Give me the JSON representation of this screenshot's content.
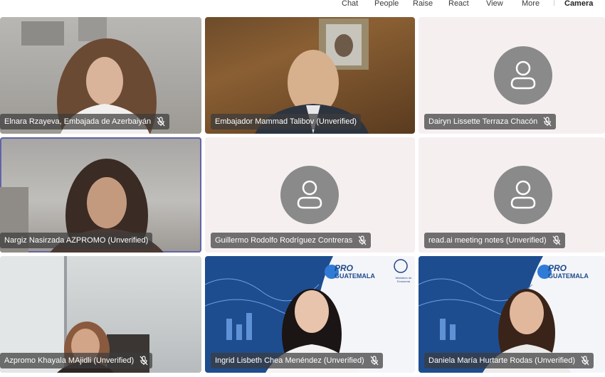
{
  "toolbar": {
    "items": [
      {
        "label": "Chat"
      },
      {
        "label": "People"
      },
      {
        "label": "Raise"
      },
      {
        "label": "React"
      },
      {
        "label": "View"
      },
      {
        "label": "More"
      },
      {
        "label": "Camera"
      }
    ]
  },
  "participants": [
    {
      "name": "Elnara Rzayeva, Embajada de Azerbaiyán",
      "muted": true,
      "video": true
    },
    {
      "name": "Embajador Mammad Talibov (Unverified)",
      "muted": false,
      "video": true
    },
    {
      "name": "Dairyn Lissette Terraza Chacón",
      "muted": true,
      "video": false
    },
    {
      "name": "Nargiz Nasirzada AZPROMO (Unverified)",
      "muted": false,
      "video": true,
      "active": true
    },
    {
      "name": "Guillermo Rodolfo Rodríguez Contreras",
      "muted": true,
      "video": false
    },
    {
      "name": "read.ai meeting notes (Unverified)",
      "muted": true,
      "video": false
    },
    {
      "name": "Azpromo Khayala MAjidli (Unverified)",
      "muted": true,
      "video": true
    },
    {
      "name": "Ingrid Lisbeth Chea Menéndez (Unverified)",
      "muted": true,
      "video": true
    },
    {
      "name": "Daniela María Hurtarte Rodas (Unverified)",
      "muted": true,
      "video": true
    }
  ],
  "branding": {
    "pro_label": "PRO",
    "guatemala_label": "GUATEMALA",
    "ministry_label": "Ministerio de Economía"
  },
  "colors": {
    "active_outline": "#6264a7",
    "name_tag_bg": "rgba(60,60,60,0.72)",
    "avatar_bg": "#8a8a8a"
  }
}
